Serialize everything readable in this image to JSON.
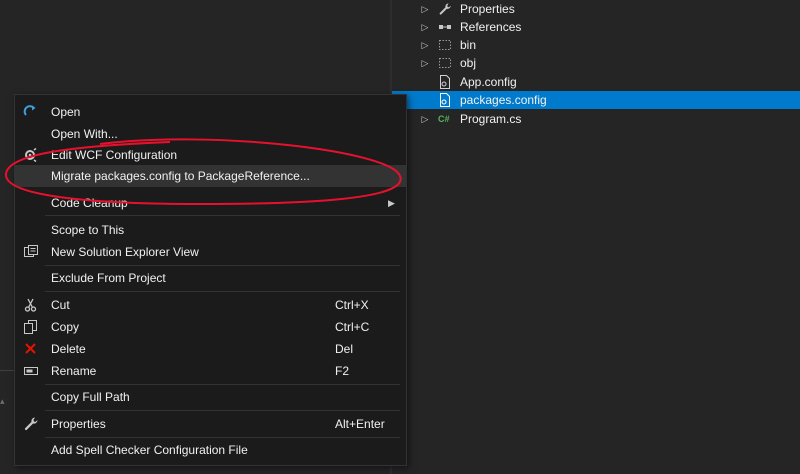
{
  "solution_explorer": {
    "items": [
      {
        "label": "Properties",
        "icon": "wrench-icon",
        "expandable": true
      },
      {
        "label": "References",
        "icon": "references-icon",
        "expandable": true
      },
      {
        "label": "bin",
        "icon": "folder-outline-icon",
        "expandable": true
      },
      {
        "label": "obj",
        "icon": "folder-outline-icon",
        "expandable": true
      },
      {
        "label": "App.config",
        "icon": "config-file-icon",
        "expandable": false
      },
      {
        "label": "packages.config",
        "icon": "config-file-icon",
        "expandable": false,
        "selected": true
      },
      {
        "label": "Program.cs",
        "icon": "csharp-file-icon",
        "expandable": true
      }
    ]
  },
  "context_menu": {
    "items": [
      {
        "label": "Open",
        "icon": "open-arrow-icon"
      },
      {
        "label": "Open With..."
      },
      {
        "label": "Edit WCF Configuration",
        "icon": "gear-icon"
      },
      {
        "label": "Migrate packages.config to PackageReference...",
        "highlighted": true
      },
      {
        "label": "Code Cleanup",
        "submenu": true
      },
      {
        "label": "Scope to This"
      },
      {
        "label": "New Solution Explorer View",
        "icon": "new-view-icon"
      },
      {
        "label": "Exclude From Project"
      },
      {
        "label": "Cut",
        "icon": "scissors-icon",
        "shortcut": "Ctrl+X"
      },
      {
        "label": "Copy",
        "icon": "copy-icon",
        "shortcut": "Ctrl+C"
      },
      {
        "label": "Delete",
        "icon": "delete-x-icon",
        "shortcut": "Del"
      },
      {
        "label": "Rename",
        "icon": "rename-icon",
        "shortcut": "F2"
      },
      {
        "label": "Copy Full Path"
      },
      {
        "label": "Properties",
        "icon": "wrench-icon",
        "shortcut": "Alt+Enter"
      },
      {
        "label": "Add Spell Checker Configuration File"
      }
    ]
  },
  "colors": {
    "background": "#252526",
    "menu_background": "#1b1b1c",
    "selection": "#007acc",
    "menu_highlight": "#333334",
    "annotation": "#e8112d",
    "text": "#f1f1f1"
  }
}
